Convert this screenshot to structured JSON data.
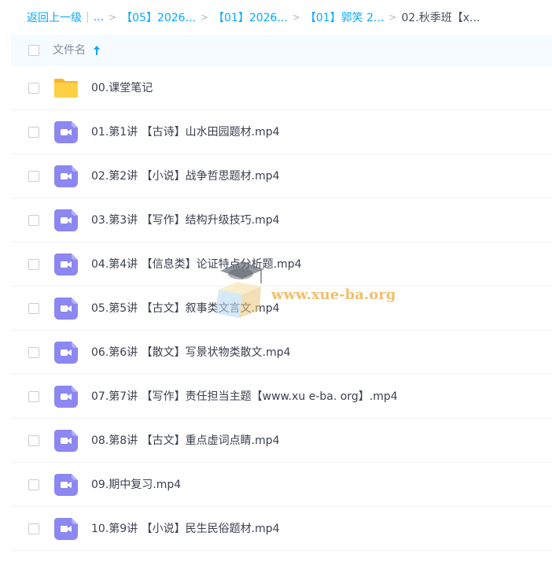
{
  "breadcrumb": {
    "back_label": "返回上一级",
    "ellipsis": "...",
    "items": [
      "【05】2026...",
      "【01】2026...",
      "【01】郭笑 2..."
    ],
    "current": "02.秋季班【x..."
  },
  "table_header": {
    "filename_label": "文件名",
    "sort_direction": "ascending"
  },
  "files": [
    {
      "name": "00.课堂笔记",
      "type": "folder"
    },
    {
      "name": "01.第1讲 【古诗】山水田园题材.mp4",
      "type": "video"
    },
    {
      "name": "02.第2讲 【小说】战争哲思题材.mp4",
      "type": "video"
    },
    {
      "name": "03.第3讲 【写作】结构升级技巧.mp4",
      "type": "video"
    },
    {
      "name": "04.第4讲 【信息类】论证特点分析题.mp4",
      "type": "video"
    },
    {
      "name": "05.第5讲 【古文】叙事类文言文.mp4",
      "type": "video"
    },
    {
      "name": "06.第6讲 【散文】写景状物类散文.mp4",
      "type": "video"
    },
    {
      "name": "07.第7讲 【写作】责任担当主题【www.xu e-ba. org】.mp4",
      "type": "video"
    },
    {
      "name": "08.第8讲 【古文】重点虚词点睛.mp4",
      "type": "video"
    },
    {
      "name": "09.期中复习.mp4",
      "type": "video"
    },
    {
      "name": "10.第9讲 【小说】民生民俗题材.mp4",
      "type": "video"
    }
  ],
  "watermark": {
    "text": "www.xue-ba.org"
  },
  "colors": {
    "link": "#06a7ff",
    "header_bg": "#f5fbff",
    "video_icon": "#8c87f1",
    "folder_icon": "#ffd043"
  }
}
